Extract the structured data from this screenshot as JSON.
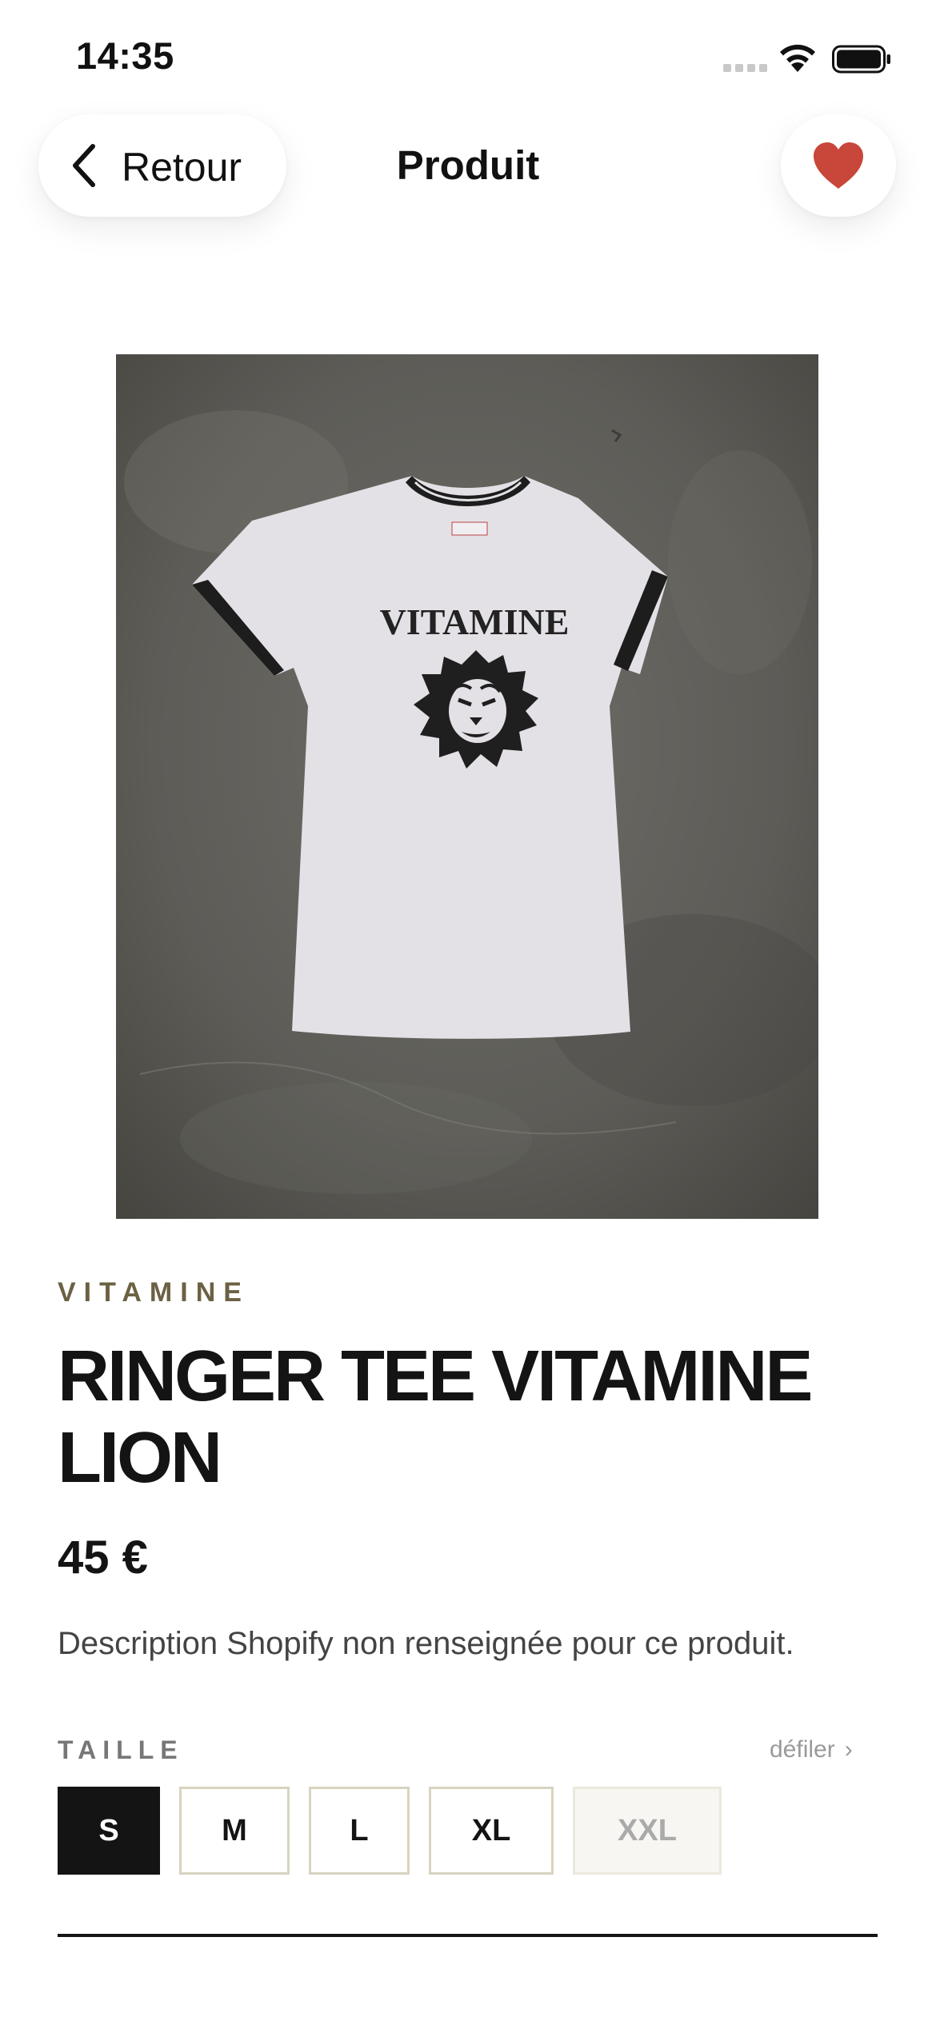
{
  "status_bar": {
    "time": "14:35",
    "icons": [
      "signal-icon",
      "wifi-icon",
      "battery-icon"
    ]
  },
  "nav": {
    "back_label": "Retour",
    "title": "Produit",
    "favorite_icon": "heart-icon",
    "favorite_color": "#c8463a"
  },
  "product": {
    "image_alt": "Ringer tee blanc VITAMINE lion sur fond béton",
    "image_print_text": "VITAMINE",
    "brand": "VITAMINE",
    "title": "RINGER TEE VITAMINE LION",
    "price": "45 €",
    "description": "Description Shopify non renseignée pour ce produit."
  },
  "sizes": {
    "label": "TAILLE",
    "scroll_hint": "défiler",
    "scroll_icon": "chevron-right-icon",
    "options": [
      {
        "label": "S",
        "state": "selected"
      },
      {
        "label": "M",
        "state": "available"
      },
      {
        "label": "L",
        "state": "available"
      },
      {
        "label": "XL",
        "state": "available"
      },
      {
        "label": "XXL",
        "state": "unavailable"
      }
    ]
  },
  "colors": {
    "text": "#141414",
    "brand": "#6b6143",
    "accent": "#c8463a",
    "border": "#d8d3bf"
  }
}
